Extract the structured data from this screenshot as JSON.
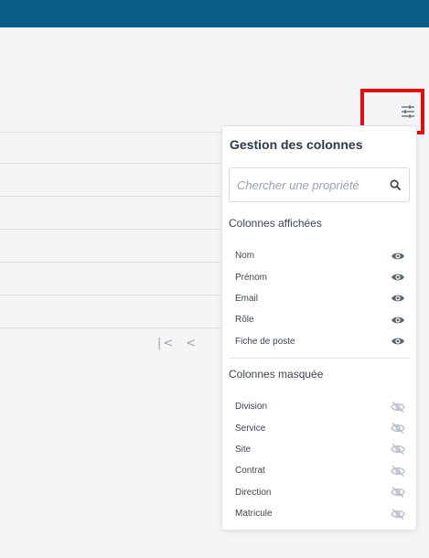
{
  "panel": {
    "title": "Gestion des colonnes",
    "search_placeholder": "Chercher une propriété",
    "shown_section": "Colonnes affichées",
    "hidden_section": "Colonnes masquée",
    "shown_columns": [
      "Nom",
      "Prénom",
      "Email",
      "Rôle",
      "Fiche de poste"
    ],
    "hidden_columns": [
      "Division",
      "Service",
      "Site",
      "Contrat",
      "Direction",
      "Matricule"
    ]
  },
  "icons": {
    "settings": "sliders-icon",
    "search": "search-icon",
    "visible": "eye-icon",
    "hidden": "eye-off-icon",
    "pager_first": "first-page-icon",
    "pager_prev": "previous-page-icon"
  },
  "colors": {
    "topbar": "#0b5e8a",
    "highlight": "#e30c0c"
  }
}
